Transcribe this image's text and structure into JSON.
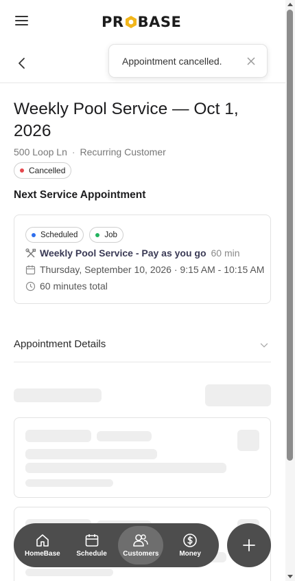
{
  "header": {
    "logo_text": "PROBASE",
    "logo_pre": "PR",
    "logo_post": "BASE",
    "logo_accent": "#f2b61b"
  },
  "toast": {
    "message": "Appointment cancelled."
  },
  "appointment": {
    "title": "Weekly Pool Service — Oct 1, 2026",
    "address": "500 Loop Ln",
    "customer_type": "Recurring Customer",
    "status": "Cancelled",
    "status_color": "#e5484d"
  },
  "next_service": {
    "section_title": "Next Service Appointment",
    "badges": [
      {
        "label": "Scheduled",
        "color": "#2f6fed"
      },
      {
        "label": "Job",
        "color": "#22b35e"
      }
    ],
    "service_name": "Weekly Pool Service - Pay as you go",
    "service_duration": "60 min",
    "date_time": "Thursday, September 10, 2026 · 9:15 AM - 10:15 AM",
    "total": "60 minutes total"
  },
  "details": {
    "label": "Appointment Details"
  },
  "bottom_nav": {
    "items": [
      {
        "label": "HomeBase",
        "icon": "home-icon"
      },
      {
        "label": "Schedule",
        "icon": "calendar-icon"
      },
      {
        "label": "Customers",
        "icon": "users-icon",
        "active": true
      },
      {
        "label": "Money",
        "icon": "dollar-icon"
      }
    ],
    "fab_icon": "plus-icon"
  }
}
